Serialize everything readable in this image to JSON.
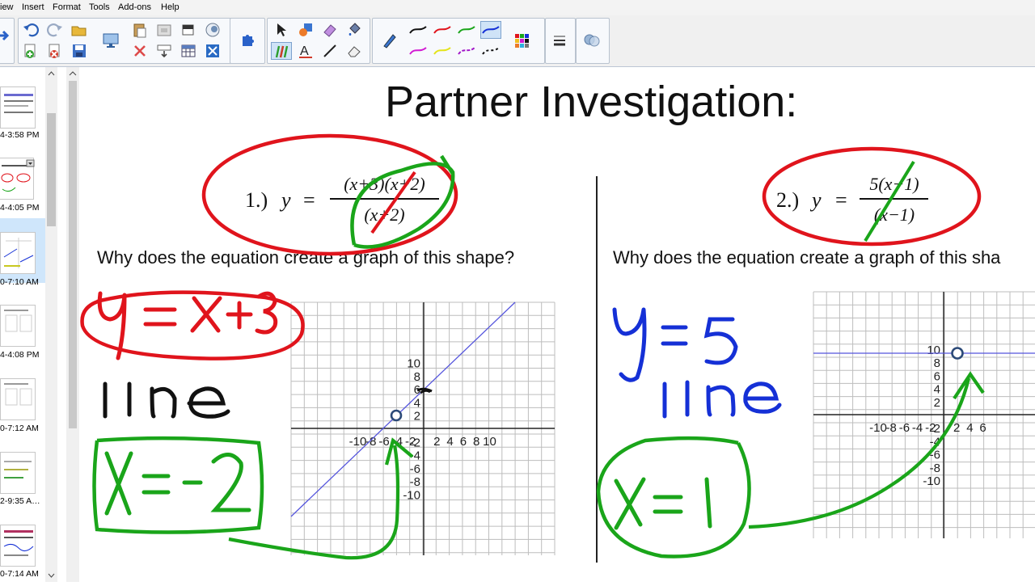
{
  "menu": {
    "items": [
      "iew",
      "Insert",
      "Format",
      "Tools",
      "Add-ons",
      "Help"
    ]
  },
  "sorter": {
    "labels": [
      "4-3:58 PM",
      "4-4:05 PM",
      "0-7:10 AM",
      "4-4:08 PM",
      "0-7:12 AM",
      "2-9:35 A…",
      "0-7:14 AM"
    ]
  },
  "page": {
    "title": "Partner Investigation:",
    "question": "Why does the equation create a graph of this shape?",
    "question_right": "Why does the equation create a graph of this sha",
    "problem1": {
      "label": "1.)",
      "var": "y",
      "eq": "=",
      "numerator": "(x+3)(x+2)",
      "denominator": "(x+2)"
    },
    "problem2": {
      "label": "2.)",
      "var": "y",
      "eq": "=",
      "numerator": "5(x−1)",
      "denominator": "(x−1)"
    },
    "ticks": {
      "left_x": [
        "-10",
        "-8",
        "-6",
        "-4",
        "-2",
        "2",
        "4",
        "6",
        "8",
        "10"
      ],
      "left_y": [
        "10",
        "8",
        "6",
        "4",
        "2",
        "-2",
        "-4",
        "-6",
        "-8",
        "-10"
      ],
      "right_x": [
        "-10",
        "-8",
        "-6",
        "-4",
        "-2",
        "2",
        "4",
        "6"
      ],
      "right_y": [
        "10",
        "8",
        "6",
        "4",
        "2",
        "-2",
        "-4",
        "-6",
        "-8",
        "-10"
      ]
    },
    "ink": {
      "red_text": "y = x+3",
      "black_text": "line",
      "green_left": "X=-2",
      "blue_text": "y=5 line",
      "green_right": "X=1"
    },
    "colors": {
      "red": "#e0141c",
      "green": "#1aa51a",
      "blue": "#1530d6",
      "graph_line": "#5555dd"
    }
  }
}
